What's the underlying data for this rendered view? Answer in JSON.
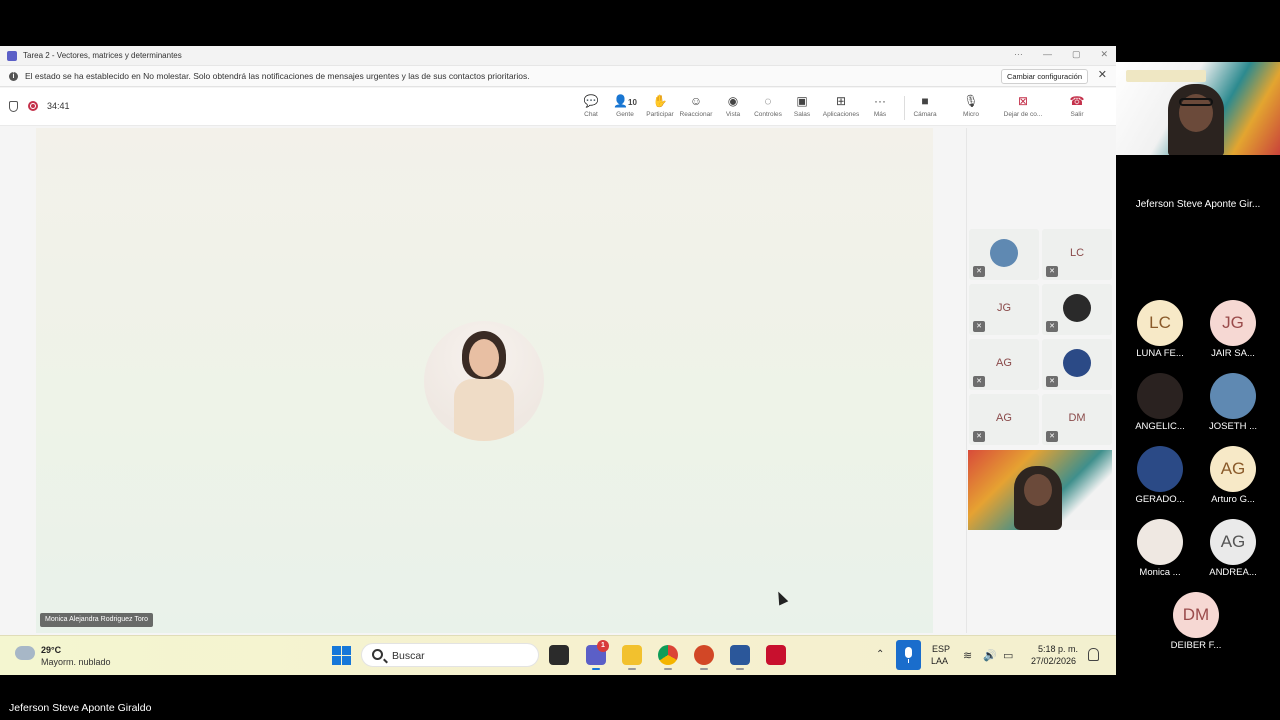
{
  "window": {
    "title": "Tarea 2 - Vectores, matrices y determinantes",
    "controls": [
      "···",
      "—",
      "▢",
      "✕"
    ]
  },
  "notice": {
    "text": "El estado se ha establecido en No molestar. Solo obtendrá las notificaciones de mensajes urgentes y las de sus contactos prioritarios.",
    "button": "Cambiar configuración"
  },
  "meeting_toolbar": {
    "timer": "34:41",
    "people_count": "10",
    "buttons": [
      {
        "label": "Chat",
        "icon": "chat-icon"
      },
      {
        "label": "Gente",
        "icon": "people-icon"
      },
      {
        "label": "Participar",
        "icon": "raise-hand-icon"
      },
      {
        "label": "Reaccionar",
        "icon": "react-icon"
      },
      {
        "label": "Vista",
        "icon": "view-icon"
      },
      {
        "label": "Controles",
        "icon": "controls-icon"
      },
      {
        "label": "Salas",
        "icon": "rooms-icon"
      },
      {
        "label": "Aplicaciones",
        "icon": "apps-icon"
      },
      {
        "label": "Más",
        "icon": "more-icon"
      },
      {
        "label": "Cámara",
        "icon": "camera-icon"
      },
      {
        "label": "Micro",
        "icon": "mic-icon"
      },
      {
        "label": "Dejar de co...",
        "icon": "stop-share-icon"
      },
      {
        "label": "Salir",
        "icon": "hangup-icon"
      }
    ]
  },
  "stage": {
    "speaker_name": "Monica Alejandra Rodriguez Toro"
  },
  "inner_grid": {
    "tiles": [
      {
        "initials": "",
        "photo": true
      },
      {
        "initials": "LC"
      },
      {
        "initials": "JG"
      },
      {
        "initials": "",
        "photo": true
      },
      {
        "initials": "AG"
      },
      {
        "initials": "",
        "photo": true
      },
      {
        "initials": "AG"
      },
      {
        "initials": "DM"
      }
    ]
  },
  "taskbar": {
    "weather_temp": "29°C",
    "weather_desc": "Mayorm. nublado",
    "search_placeholder": "Buscar",
    "teams_badge": "1",
    "lang_line1": "ESP",
    "lang_line2": "LAA",
    "time": "5:18 p. m.",
    "date": "27/02/2026"
  },
  "gallery": {
    "presenter_name": "Jeferson Steve Aponte Gir...",
    "participants": [
      {
        "initials": "LC",
        "name": "LUNA FE...",
        "color": "#f7e9c7"
      },
      {
        "initials": "JG",
        "name": "JAIR SA...",
        "color": "#f6d8d3"
      },
      {
        "initials": "",
        "name": "ANGELIC...",
        "color": "photo"
      },
      {
        "initials": "",
        "name": "JOSETH ...",
        "color": "photo"
      },
      {
        "initials": "",
        "name": "GERADO...",
        "color": "photo"
      },
      {
        "initials": "AG",
        "name": "Arturo G...",
        "color": "#f7e9c7"
      },
      {
        "initials": "",
        "name": "Monica ...",
        "color": "photo"
      },
      {
        "initials": "AG",
        "name": "ANDREA...",
        "color": "#eaeaea"
      },
      {
        "initials": "DM",
        "name": "DEIBER F...",
        "color": "#f6d8d3"
      }
    ]
  },
  "bottom_label": "Jeferson Steve Aponte Giraldo"
}
